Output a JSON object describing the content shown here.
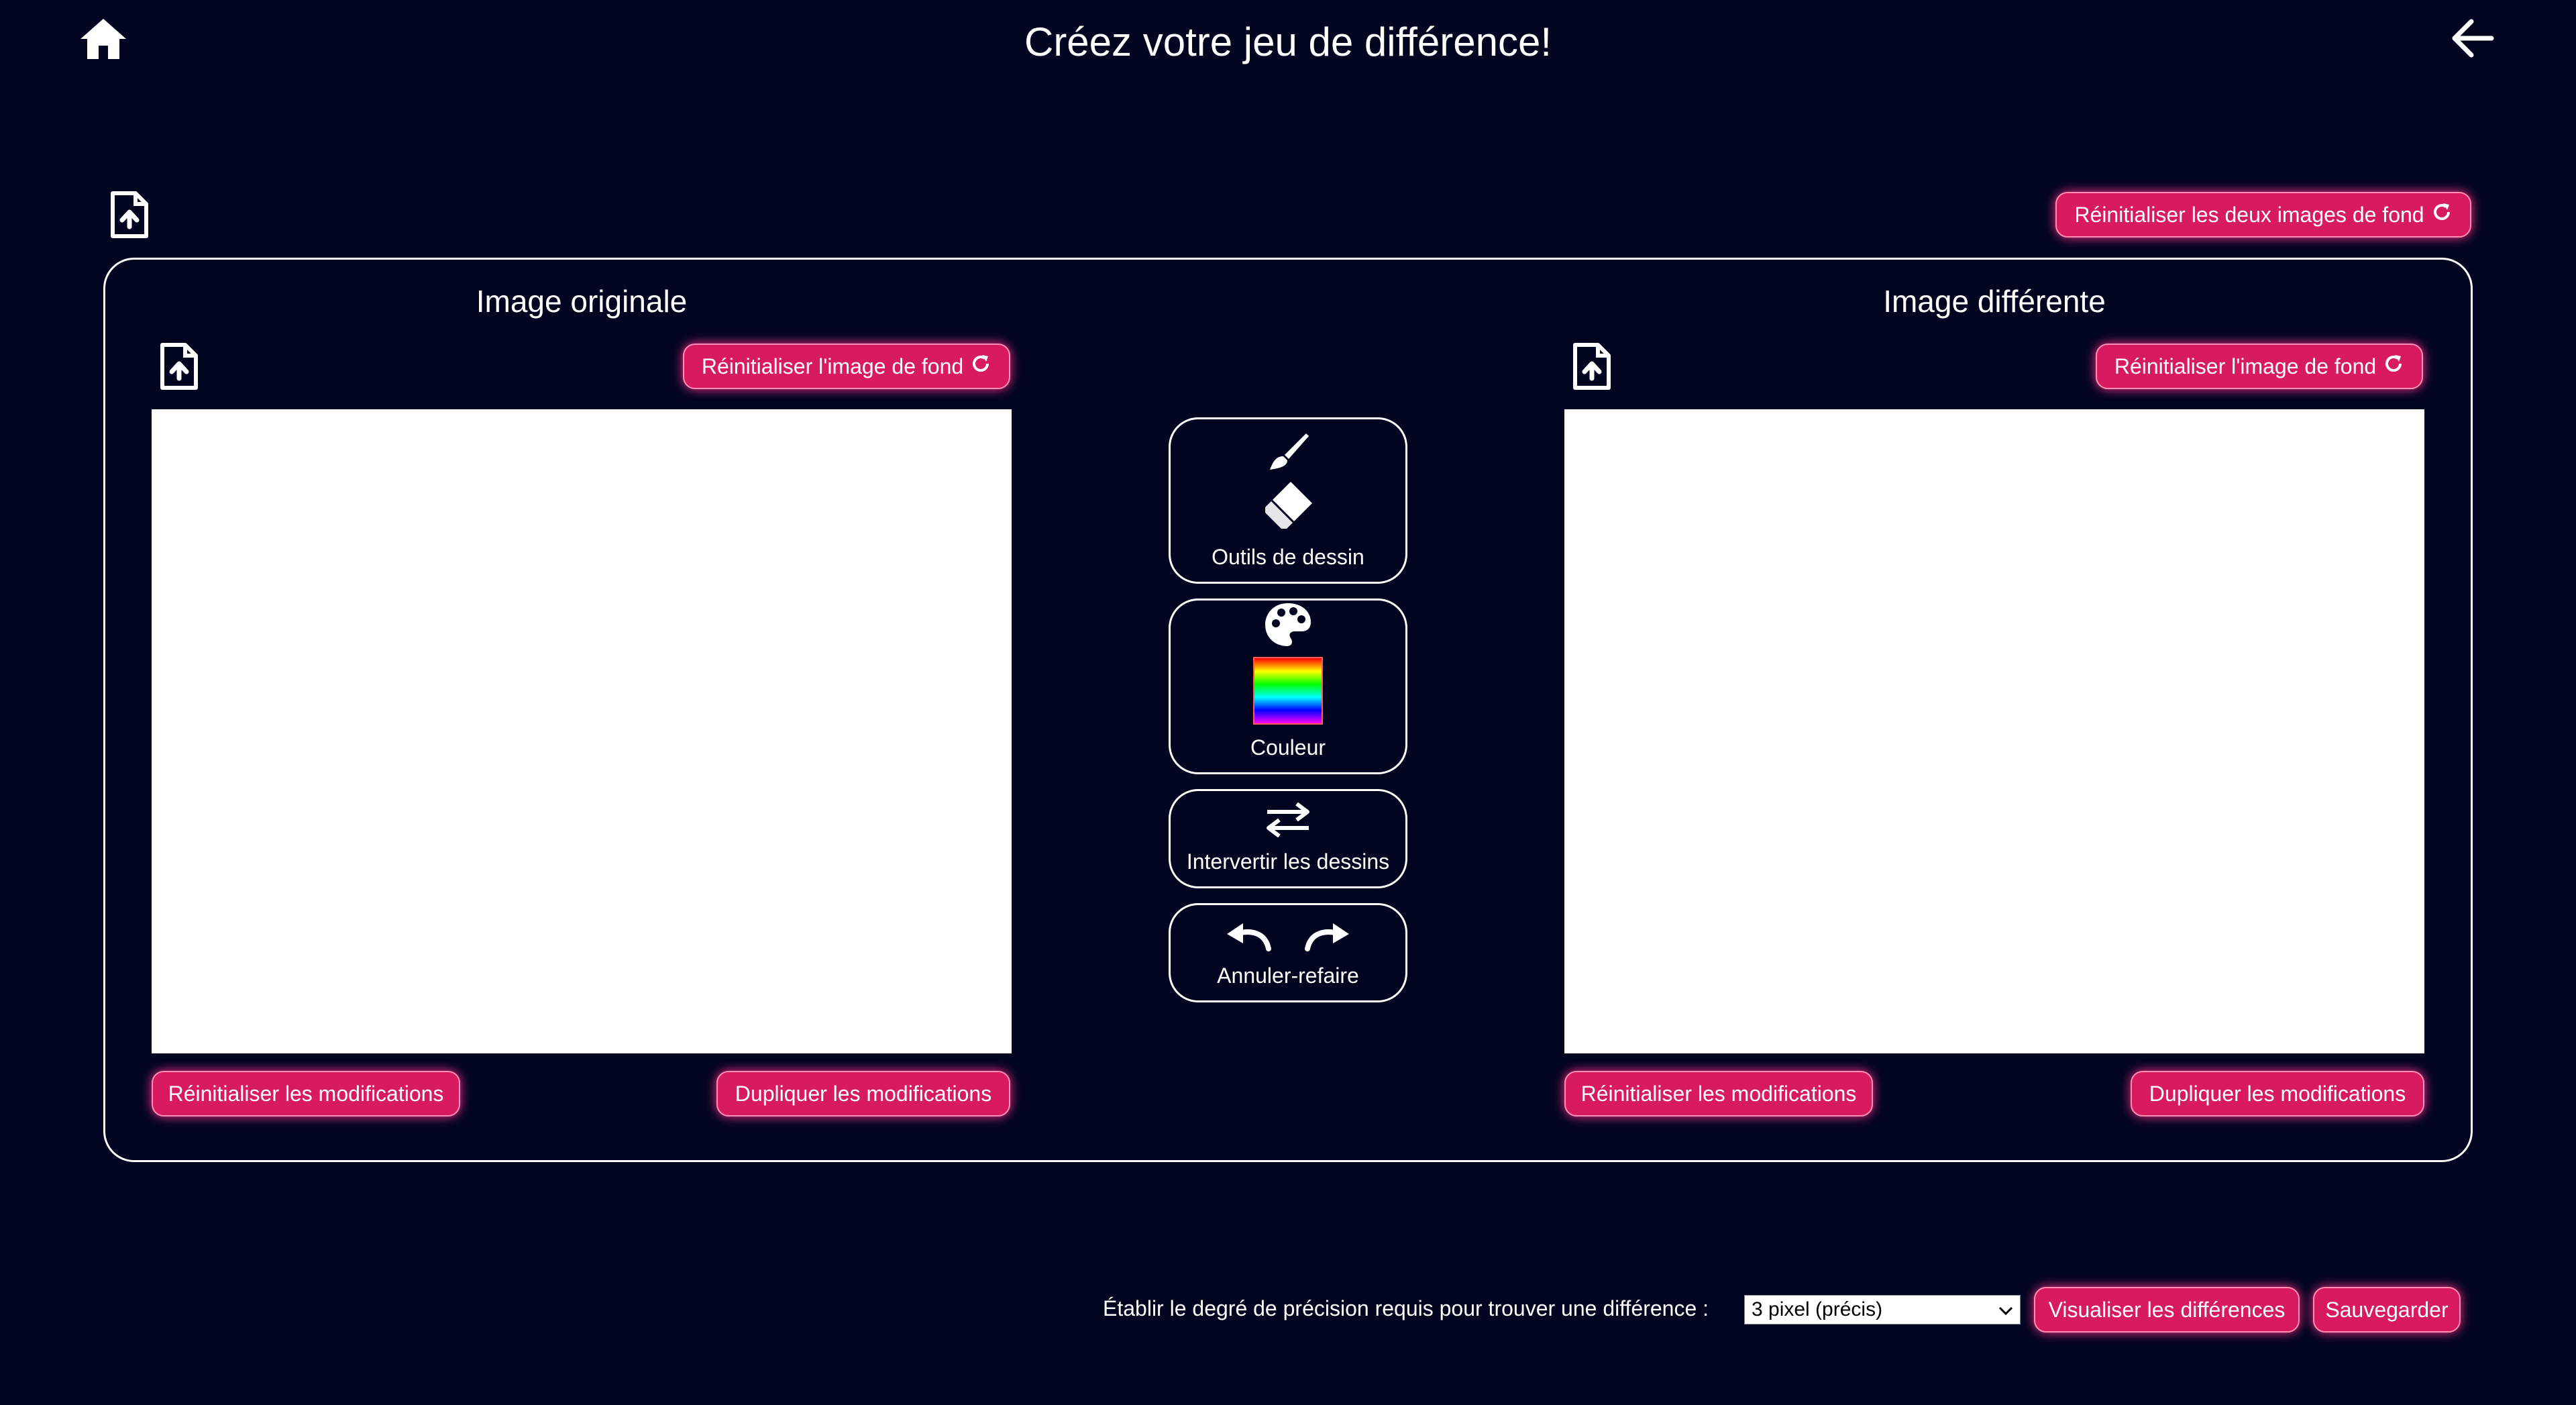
{
  "page": {
    "title": "Créez votre jeu de différence!"
  },
  "actions": {
    "reset_both_backgrounds": "Réinitialiser les deux images de fond"
  },
  "left": {
    "title": "Image originale",
    "reset_background": "Réinitialiser l'image de fond",
    "reset_changes": "Réinitialiser les modifications",
    "duplicate_changes": "Dupliquer les modifications"
  },
  "right": {
    "title": "Image différente",
    "reset_background": "Réinitialiser l'image de fond",
    "reset_changes": "Réinitialiser les modifications",
    "duplicate_changes": "Dupliquer les modifications"
  },
  "tools": {
    "drawing": "Outils de dessin",
    "color": "Couleur",
    "swap": "Intervertir les dessins",
    "undo_redo": "Annuler-refaire"
  },
  "footer": {
    "precision_label": "Établir le degré de précision requis pour trouver une différence :",
    "precision_value": "3 pixel (précis)",
    "visualize": "Visualiser les différences",
    "save": "Sauvegarder"
  },
  "colors": {
    "background": "#020520",
    "accent": "#d81b60",
    "glow": "#ff2f86"
  },
  "icons": [
    "home-icon",
    "arrow-left-icon",
    "file-upload-icon",
    "refresh-icon",
    "brush-icon",
    "eraser-icon",
    "palette-icon",
    "swap-icon",
    "undo-icon",
    "redo-icon",
    "chevron-down-icon"
  ]
}
